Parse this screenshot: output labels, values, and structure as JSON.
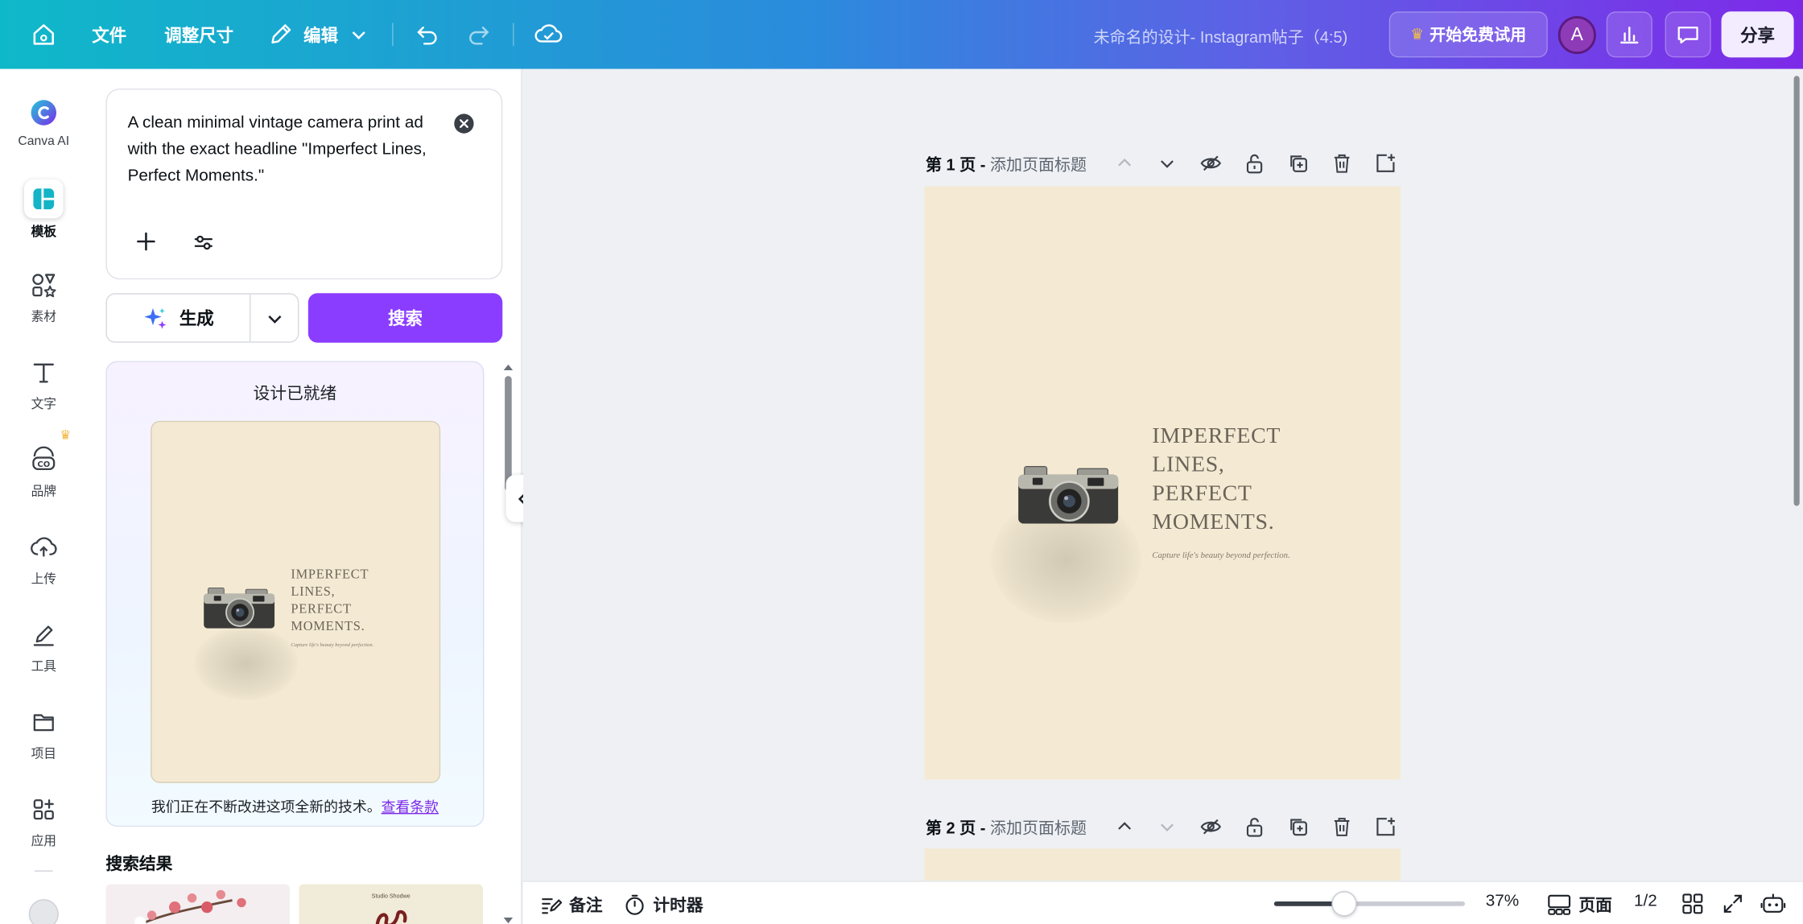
{
  "topbar": {
    "file_menu": "文件",
    "resize_menu": "调整尺寸",
    "edit_menu": "编辑",
    "doc_title": "未命名的设计- Instagram帖子（4:5)",
    "trial_button": "开始免费试用",
    "avatar_initial": "A",
    "share_button": "分享"
  },
  "rail": {
    "canva_ai": "Canva AI",
    "templates": "模板",
    "elements": "素材",
    "text": "文字",
    "brand": "品牌",
    "uploads": "上传",
    "tools": "工具",
    "projects": "项目",
    "apps": "应用"
  },
  "panel": {
    "prompt_text": "A clean minimal vintage camera print ad with the exact headline \"Imperfect Lines, Perfect Moments.\"",
    "generate_button": "生成",
    "search_button": "搜索",
    "ready_title": "设计已就绪",
    "ready_note": "我们正在不断改进这项全新的技术。",
    "terms_link": "查看条款",
    "results_title": "搜索结果",
    "result_2_caption": "Studio Shodwe"
  },
  "design": {
    "headline_lines": [
      "IMPERFECT",
      "LINES,",
      "PERFECT",
      "MOMENTS."
    ],
    "tagline": "Capture life's beauty beyond perfection."
  },
  "pages": [
    {
      "number": "第 1 页 -",
      "title_placeholder": "添加页面标题"
    },
    {
      "number": "第 2 页 -",
      "title_placeholder": "添加页面标题"
    }
  ],
  "bottombar": {
    "notes": "备注",
    "timer": "计时器",
    "zoom": "37%",
    "zoom_fraction": 0.37,
    "pages_view": "页面",
    "page_counter": "1/2"
  },
  "colors": {
    "accent": "#8b3dff",
    "artboard": "#f4ead3",
    "headline": "#6c6459"
  }
}
